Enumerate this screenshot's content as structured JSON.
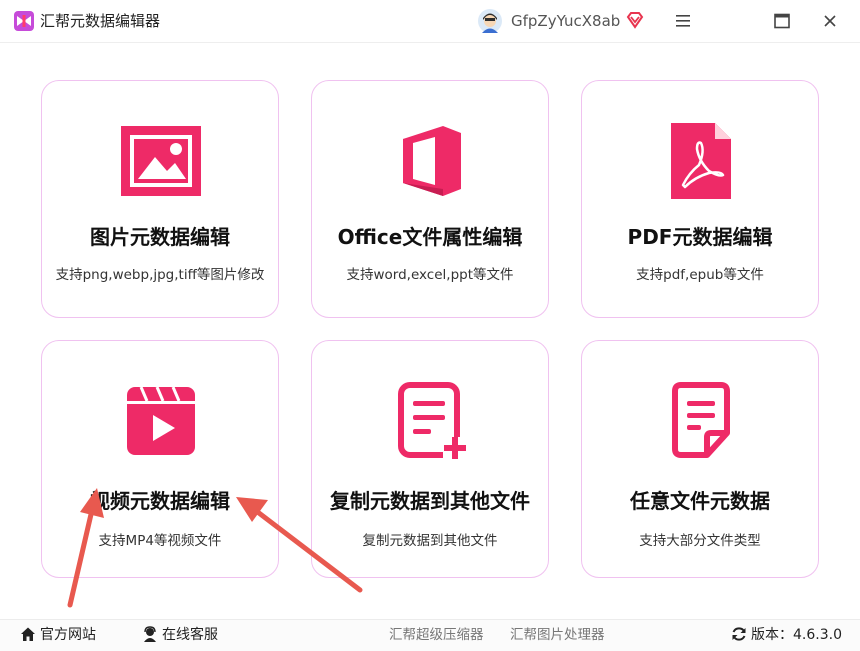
{
  "titlebar": {
    "app_title": "汇帮元数据编辑器",
    "username": "GfpZyYucX8ab",
    "icons": [
      "app-logo",
      "user-avatar",
      "vip-badge-icon",
      "menu-icon",
      "maximize-icon",
      "close-icon"
    ]
  },
  "cards": [
    {
      "title": "图片元数据编辑",
      "desc": "支持png,webp,jpg,tiff等图片修改",
      "icon": "image-icon"
    },
    {
      "title": "Office文件属性编辑",
      "desc": "支持word,excel,ppt等文件",
      "icon": "office-icon"
    },
    {
      "title": "PDF元数据编辑",
      "desc": "支持pdf,epub等文件",
      "icon": "pdf-icon"
    },
    {
      "title": "视频元数据编辑",
      "desc": "支持MP4等视频文件",
      "icon": "video-icon"
    },
    {
      "title": "复制元数据到其他文件",
      "desc": "复制元数据到其他文件",
      "icon": "copy-doc-icon"
    },
    {
      "title": "任意文件元数据",
      "desc": "支持大部分文件类型",
      "icon": "file-icon"
    }
  ],
  "footer": {
    "website": "官方网站",
    "support": "在线客服",
    "compressor": "汇帮超级压缩器",
    "image_processor": "汇帮图片处理器",
    "version": "版本：4.6.3.0"
  },
  "colors": {
    "accent": "#ee2a67",
    "card_border": "#f0c2f0",
    "arrow": "#e8594f"
  }
}
